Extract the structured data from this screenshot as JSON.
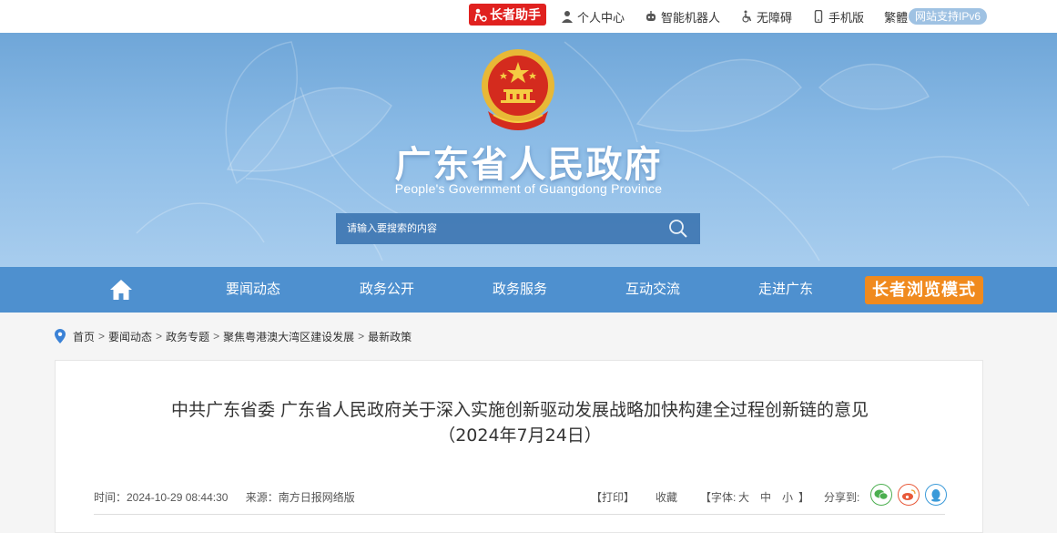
{
  "topbar": {
    "elder_helper": "长者助手",
    "links": [
      "个人中心",
      "智能机器人",
      "无障碍",
      "手机版",
      "繁體"
    ],
    "ipv6": "网站支持IPv6"
  },
  "banner": {
    "title": "广东省人民政府",
    "subtitle": "People's Government of Guangdong Province",
    "search_placeholder": "请输入要搜索的内容"
  },
  "nav": {
    "items": [
      "要闻动态",
      "政务公开",
      "政务服务",
      "互动交流",
      "走进广东"
    ],
    "elder_mode": "长者浏览模式"
  },
  "breadcrumb": [
    "首页",
    "要闻动态",
    "政务专题",
    "聚焦粤港澳大湾区建设发展",
    "最新政策"
  ],
  "article": {
    "title_line1": "中共广东省委 广东省人民政府关于深入实施创新驱动发展战略加快构建全过程创新链的意见",
    "title_line2": "（2024年7月24日）",
    "time": "时间：2024-10-29 08:44:30",
    "source": "来源：南方日报网络版",
    "print": "【打印】",
    "favorite": "收藏",
    "font_label": "【字体:",
    "font_large": "大",
    "font_medium": "中",
    "font_small": "小",
    "font_close": "】",
    "share_label": "分享到:"
  },
  "colors": {
    "primary_blue": "#4e90cf",
    "elder_red": "#e0211f",
    "elder_orange": "#f08a1e",
    "wechat_green": "#4caf50",
    "weibo_red": "#e85a3a",
    "qq_blue": "#3a9ad9"
  }
}
